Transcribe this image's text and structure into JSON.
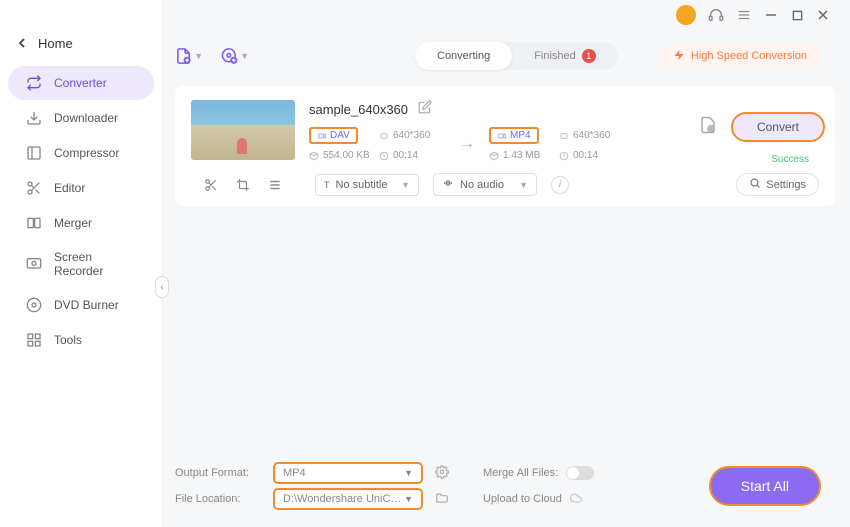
{
  "titlebar": {},
  "sidebar": {
    "home": "Home",
    "items": [
      {
        "label": "Converter"
      },
      {
        "label": "Downloader"
      },
      {
        "label": "Compressor"
      },
      {
        "label": "Editor"
      },
      {
        "label": "Merger"
      },
      {
        "label": "Screen Recorder"
      },
      {
        "label": "DVD Burner"
      },
      {
        "label": "Tools"
      }
    ]
  },
  "tabs": {
    "converting": "Converting",
    "finished": "Finished",
    "finished_badge": "1"
  },
  "high_speed": "High Speed Conversion",
  "file": {
    "name": "sample_640x360",
    "src_format": "DAV",
    "src_res": "640*360",
    "src_size": "554.00 KB",
    "src_dur": "00:14",
    "dst_format": "MP4",
    "dst_res": "640*360",
    "dst_size": "1.43 MB",
    "dst_dur": "00:14",
    "convert_btn": "Convert",
    "status": "Success",
    "subtitle": "No subtitle",
    "audio": "No audio",
    "settings": "Settings"
  },
  "bottom": {
    "output_format_label": "Output Format:",
    "output_format": "MP4",
    "file_location_label": "File Location:",
    "file_location": "D:\\Wondershare UniConverter 1",
    "merge_label": "Merge All Files:",
    "upload_label": "Upload to Cloud",
    "start_all": "Start All"
  }
}
